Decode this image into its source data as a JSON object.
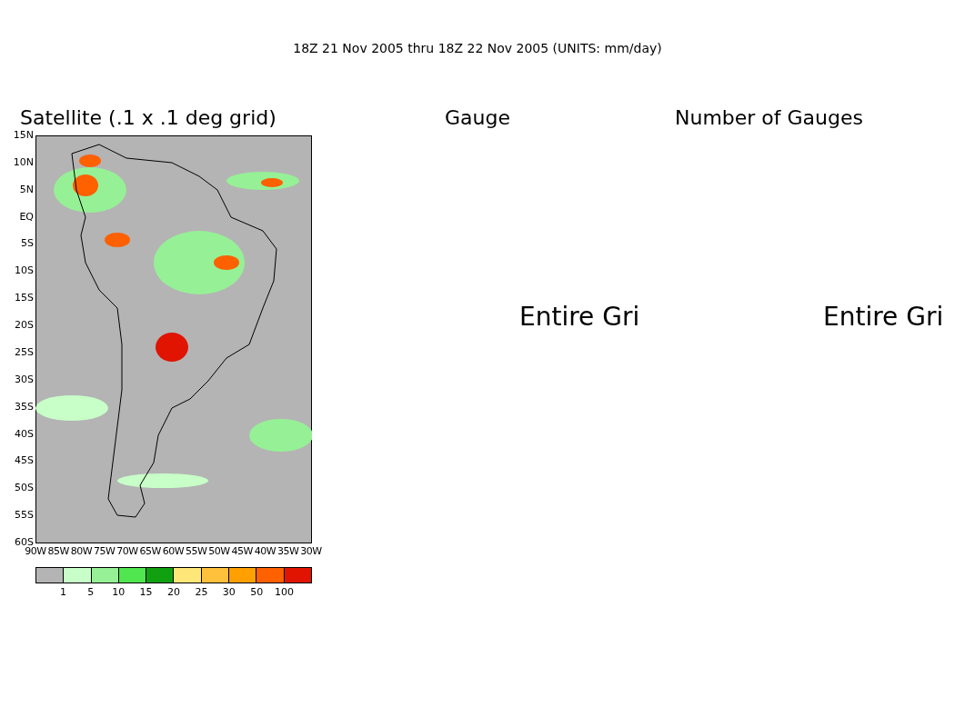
{
  "title": "18Z 21 Nov 2005 thru 18Z 22 Nov 2005 (UNITS: mm/day)",
  "panels": [
    {
      "kind": "map",
      "title": "Satellite (.1 x .1 deg grid)",
      "y_ticks": [
        "15N",
        "10N",
        "5N",
        "EQ",
        "5S",
        "10S",
        "15S",
        "20S",
        "25S",
        "30S",
        "35S",
        "40S",
        "45S",
        "50S",
        "55S",
        "60S"
      ],
      "x_ticks": [
        "90W",
        "85W",
        "80W",
        "75W",
        "70W",
        "65W",
        "60W",
        "55W",
        "50W",
        "45W",
        "40W",
        "35W",
        "30W"
      ],
      "legend": {
        "swatches": [
          {
            "color": "#b4b4b4"
          },
          {
            "color": "#c8ffc8"
          },
          {
            "color": "#96f096"
          },
          {
            "color": "#50e650"
          },
          {
            "color": "#10a010"
          },
          {
            "color": "#ffe678"
          },
          {
            "color": "#ffc03c"
          },
          {
            "color": "#ffa000"
          },
          {
            "color": "#ff6000"
          },
          {
            "color": "#e01400"
          }
        ],
        "labels": [
          "1",
          "5",
          "10",
          "15",
          "20",
          "25",
          "30",
          "50",
          "100"
        ]
      }
    },
    {
      "kind": "empty",
      "title": "Gauge",
      "message": "Entire Gri"
    },
    {
      "kind": "empty",
      "title": "Number of Gauges",
      "message": "Entire Gri"
    }
  ]
}
